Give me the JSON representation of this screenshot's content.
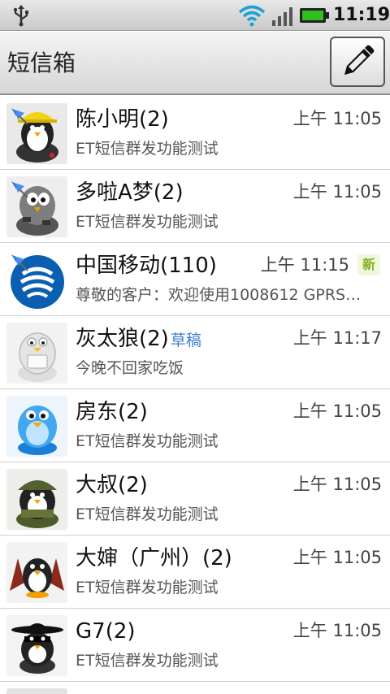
{
  "status_bar": {
    "time": "11:19",
    "icons": [
      "usb-icon",
      "wifi-icon",
      "signal-icon",
      "battery-icon"
    ],
    "battery_color": "#2fbf1f"
  },
  "header": {
    "title": "短信箱",
    "compose_icon": "pencil-icon"
  },
  "colors": {
    "draft": "#3a7fd0",
    "new_badge": "#7fb21f",
    "divider": "#cfcfcf"
  },
  "conversations": [
    {
      "name": "陈小明(2)",
      "draft": "",
      "time": "上午 11:05",
      "preview": "ET短信群发功能测试",
      "pinned": true,
      "new": "",
      "avatar": "penguin-yellow-hat-avatar"
    },
    {
      "name": "多啦A梦(2)",
      "draft": "",
      "time": "上午 11:05",
      "preview": "ET短信群发功能测试",
      "pinned": true,
      "new": "",
      "avatar": "penguin-camo-avatar"
    },
    {
      "name": "中国移动(110)",
      "draft": "",
      "time": "上午 11:15",
      "preview": "尊敬的客户：欢迎使用1008612 GPRS…",
      "pinned": true,
      "new": "新",
      "avatar": "china-mobile-logo-avatar"
    },
    {
      "name": "灰太狼(2)",
      "draft": "草稿",
      "time": "上午 11:17",
      "preview": "今晚不回家吃饭",
      "pinned": false,
      "new": "",
      "avatar": "penguin-white-avatar"
    },
    {
      "name": "房东(2)",
      "draft": "",
      "time": "上午 11:05",
      "preview": "ET短信群发功能测试",
      "pinned": false,
      "new": "",
      "avatar": "penguin-blue-avatar"
    },
    {
      "name": "大叔(2)",
      "draft": "",
      "time": "上午 11:05",
      "preview": "ET短信群发功能测试",
      "pinned": false,
      "new": "",
      "avatar": "penguin-soldier-avatar"
    },
    {
      "name": "大婶（广州）(2)",
      "draft": "",
      "time": "上午 11:05",
      "preview": "ET短信群发功能测试",
      "pinned": false,
      "new": "",
      "avatar": "penguin-wings-avatar"
    },
    {
      "name": "G7(2)",
      "draft": "",
      "time": "上午 11:05",
      "preview": "ET短信群发功能测试",
      "pinned": false,
      "new": "",
      "avatar": "penguin-zorro-avatar"
    }
  ]
}
